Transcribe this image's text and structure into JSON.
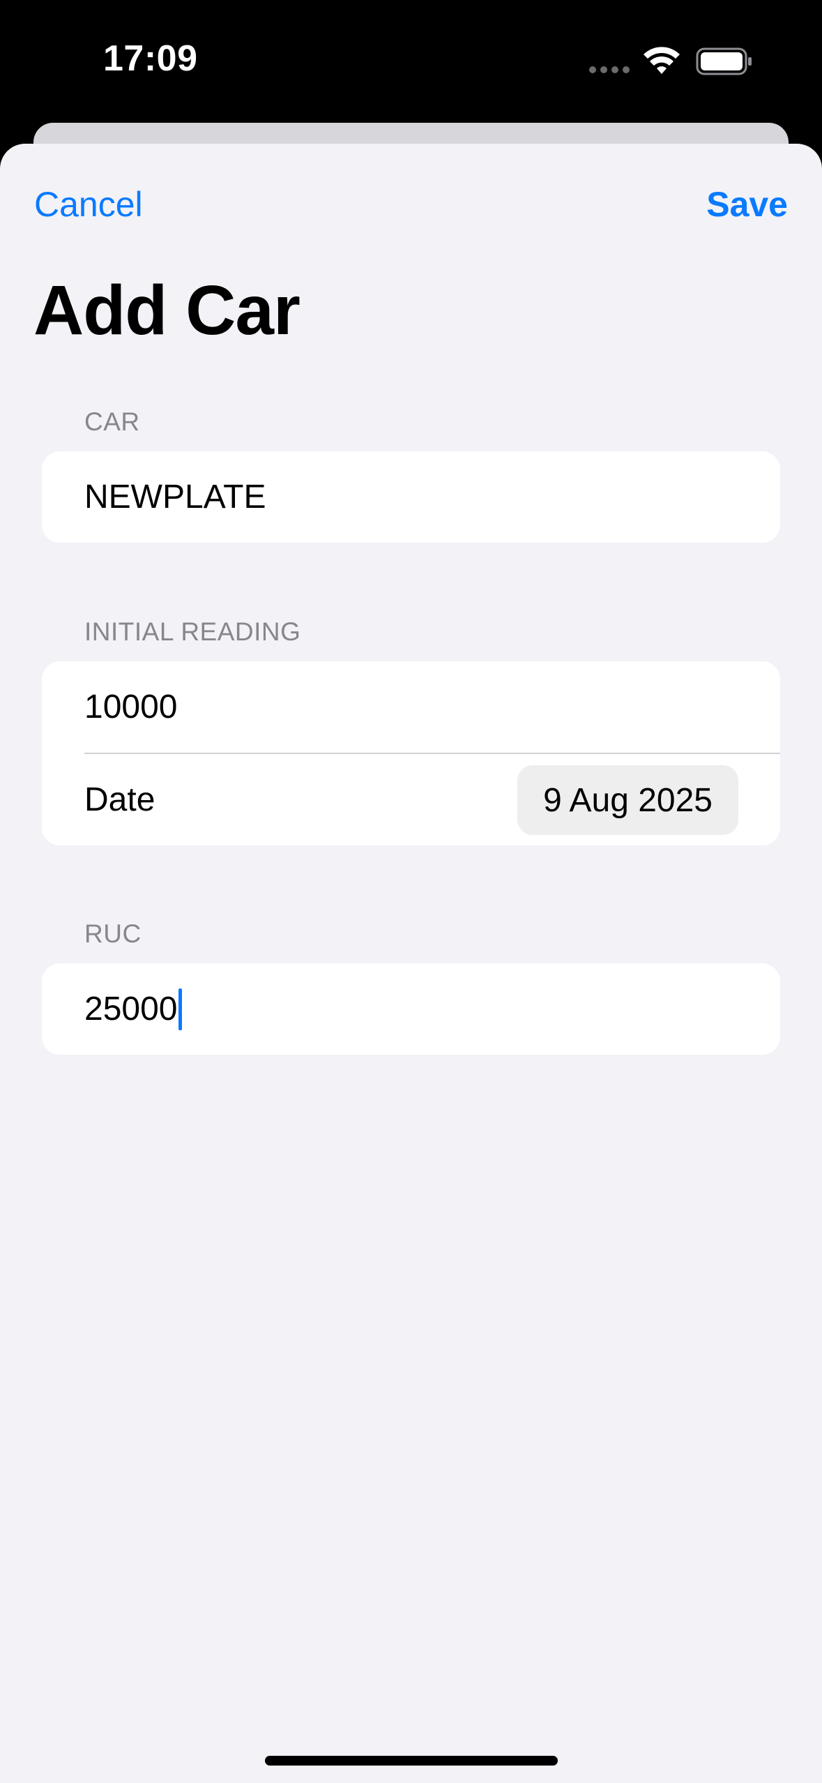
{
  "status_bar": {
    "time": "17:09",
    "icons": [
      "signal-dots-icon",
      "wifi-icon",
      "battery-icon"
    ]
  },
  "nav": {
    "cancel_label": "Cancel",
    "save_label": "Save",
    "accent_color": "#0a7aff"
  },
  "title": "Add Car",
  "sections": {
    "car": {
      "header": "CAR",
      "plate_value": "NEWPLATE"
    },
    "initial_reading": {
      "header": "INITIAL READING",
      "reading_value": "10000",
      "date_label": "Date",
      "date_value": "9 Aug 2025"
    },
    "ruc": {
      "header": "RUC",
      "ruc_value": "25000"
    }
  }
}
